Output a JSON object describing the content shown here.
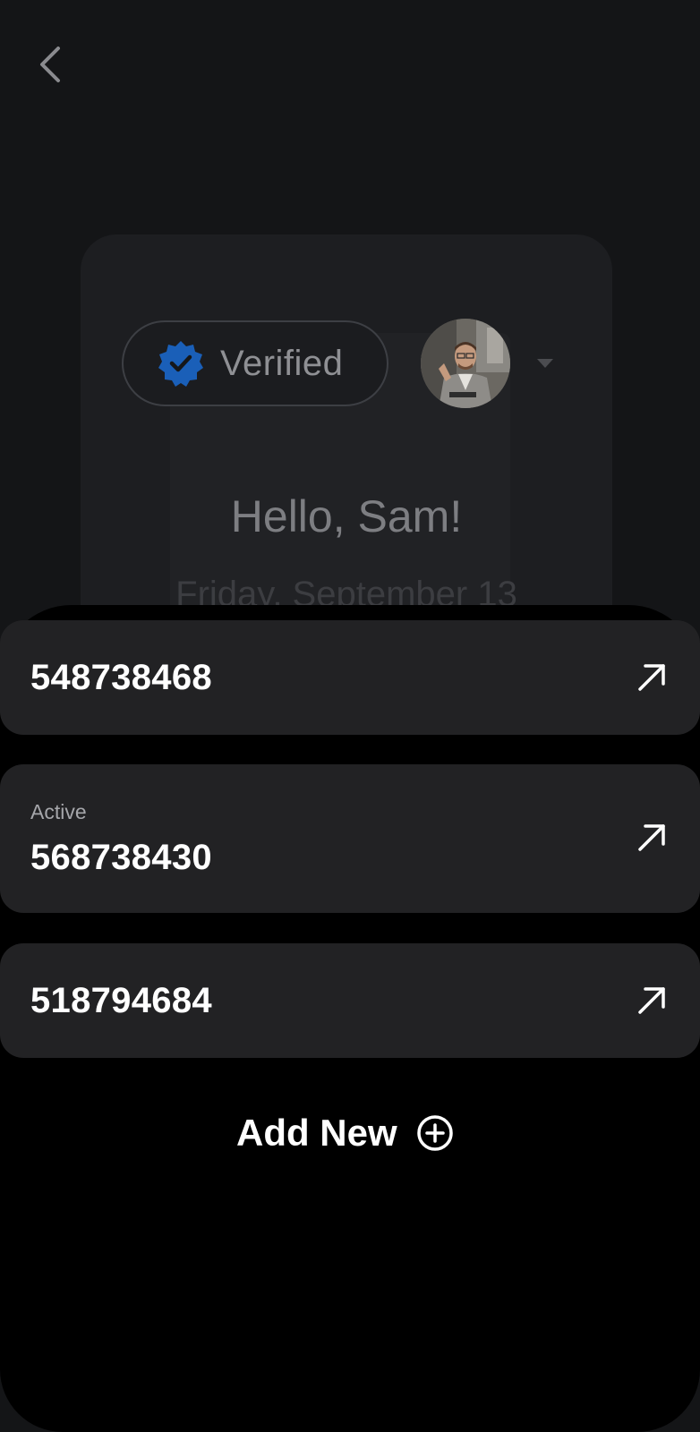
{
  "header": {
    "back_icon": "chevron-left-icon"
  },
  "profile_card": {
    "verified_label": "Verified",
    "verified_icon": "verified-badge-icon",
    "badge_color": "#1f6fd1",
    "greeting": "Hello, Sam!",
    "date": "Friday, September 13"
  },
  "accounts": [
    {
      "number": "548738468",
      "status": "",
      "icon": "arrow-up-right-icon"
    },
    {
      "number": "568738430",
      "status": "Active",
      "icon": "arrow-up-right-icon"
    },
    {
      "number": "518794684",
      "status": "",
      "icon": "arrow-up-right-icon"
    }
  ],
  "add_new": {
    "label": "Add New",
    "icon": "plus-circle-icon"
  },
  "colors": {
    "sheet_background": "#000000",
    "row_background": "#222224",
    "text_primary": "#ffffff",
    "text_secondary": "#a5a6aa"
  }
}
